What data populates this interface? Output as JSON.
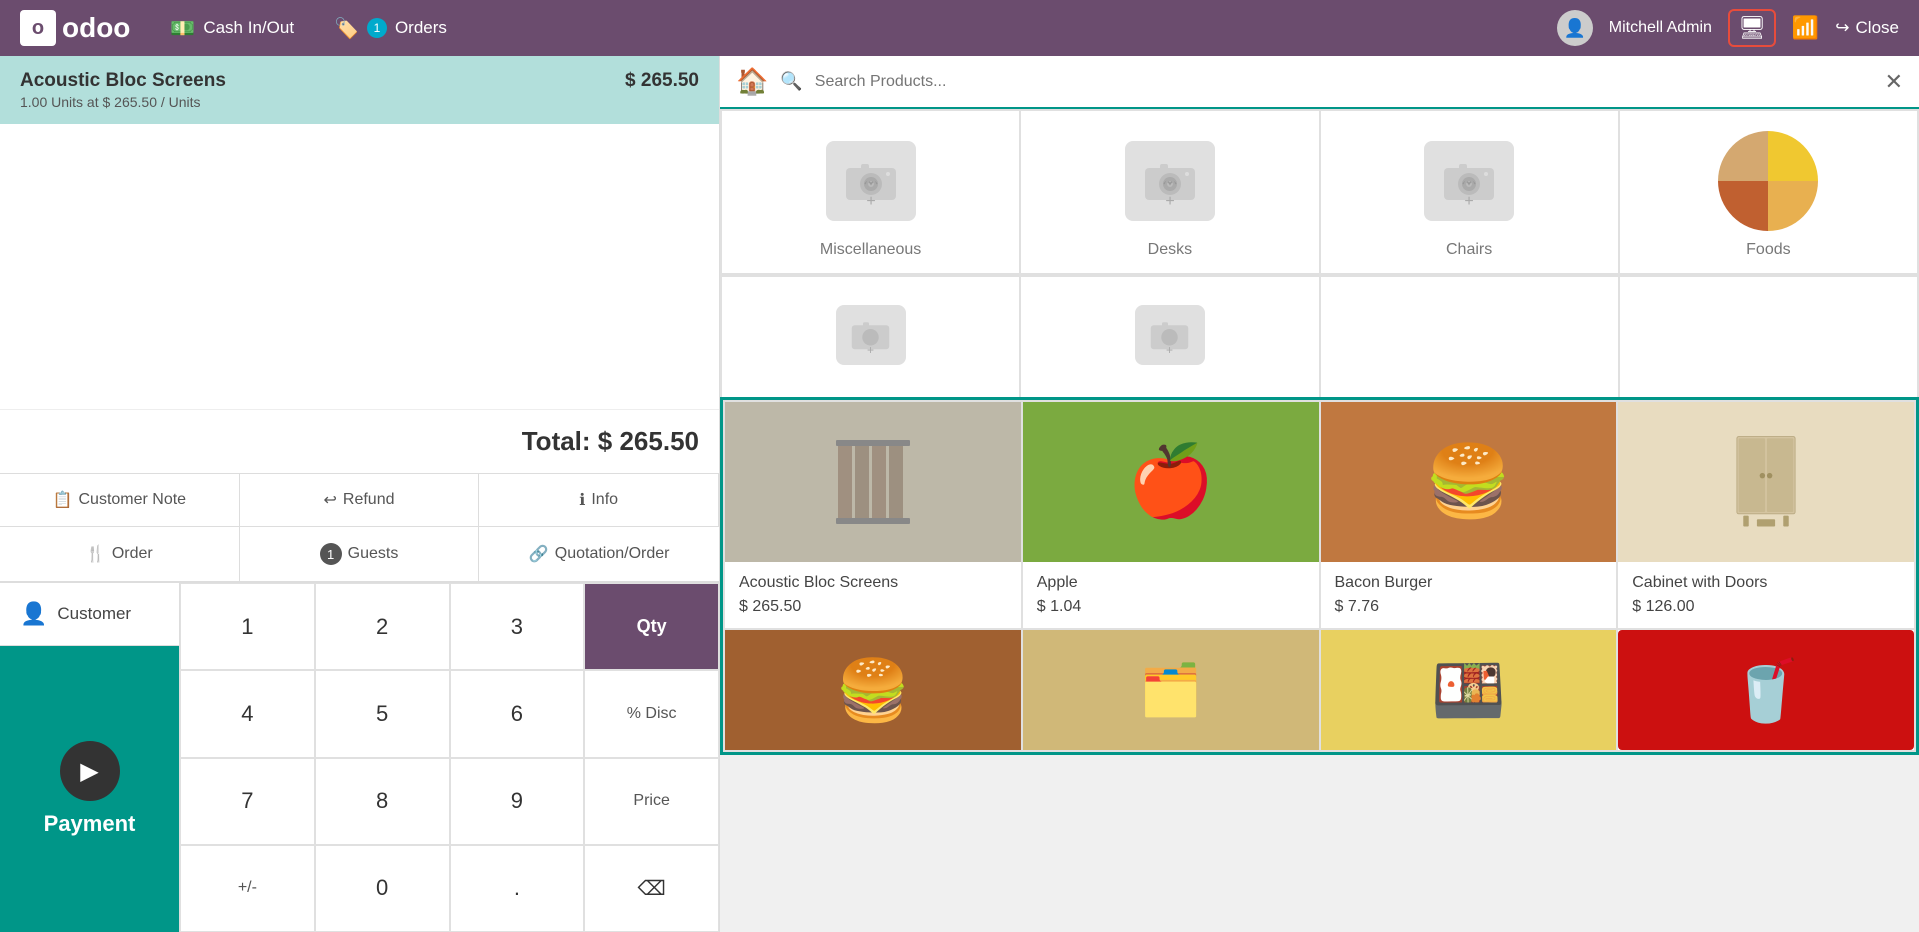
{
  "nav": {
    "logo": "odoo",
    "cash_in_out": "Cash In/Out",
    "orders": "Orders",
    "orders_badge": "1",
    "user_name": "Mitchell Admin",
    "close_label": "Close"
  },
  "order": {
    "item_name": "Acoustic Bloc Screens",
    "item_price": "$ 265.50",
    "item_detail": "1.00  Units at $ 265.50 / Units",
    "total_label": "Total: $ 265.50"
  },
  "action_buttons": [
    {
      "icon": "note",
      "label": "Customer Note"
    },
    {
      "icon": "refund",
      "label": "Refund"
    },
    {
      "icon": "info",
      "label": "Info"
    },
    {
      "icon": "order",
      "label": "Order"
    },
    {
      "icon": "guests",
      "label": "Guests",
      "badge": "1"
    },
    {
      "icon": "quotation",
      "label": "Quotation/Order"
    }
  ],
  "customer": {
    "label": "Customer"
  },
  "numpad": {
    "keys": [
      "1",
      "2",
      "3",
      "4",
      "5",
      "6",
      "7",
      "8",
      "9",
      "+/-",
      "0",
      "."
    ],
    "special_keys": [
      "Qty",
      "% Disc",
      "Price",
      "⌫"
    ]
  },
  "payment": {
    "label": "Payment"
  },
  "search": {
    "placeholder": "Search Products..."
  },
  "categories": [
    {
      "id": "misc",
      "label": "Miscellaneous",
      "has_image": false
    },
    {
      "id": "desks",
      "label": "Desks",
      "has_image": false
    },
    {
      "id": "chairs",
      "label": "Chairs",
      "has_image": false
    },
    {
      "id": "foods",
      "label": "Foods",
      "has_image": true
    }
  ],
  "categories_row2": [
    {
      "id": "cat5",
      "label": "",
      "has_image": false
    },
    {
      "id": "cat6",
      "label": "",
      "has_image": false
    }
  ],
  "products": [
    {
      "id": "acoustic",
      "name": "Acoustic Bloc Screens",
      "price": "$ 265.50"
    },
    {
      "id": "apple",
      "name": "Apple",
      "price": "$ 1.04"
    },
    {
      "id": "bacon_burger",
      "name": "Bacon Burger",
      "price": "$ 7.76"
    },
    {
      "id": "cabinet",
      "name": "Cabinet with Doors",
      "price": "$ 126.00"
    },
    {
      "id": "burger2",
      "name": "",
      "price": ""
    },
    {
      "id": "wood",
      "name": "",
      "price": ""
    },
    {
      "id": "cheese",
      "name": "",
      "price": ""
    },
    {
      "id": "cola",
      "name": "",
      "price": ""
    }
  ]
}
